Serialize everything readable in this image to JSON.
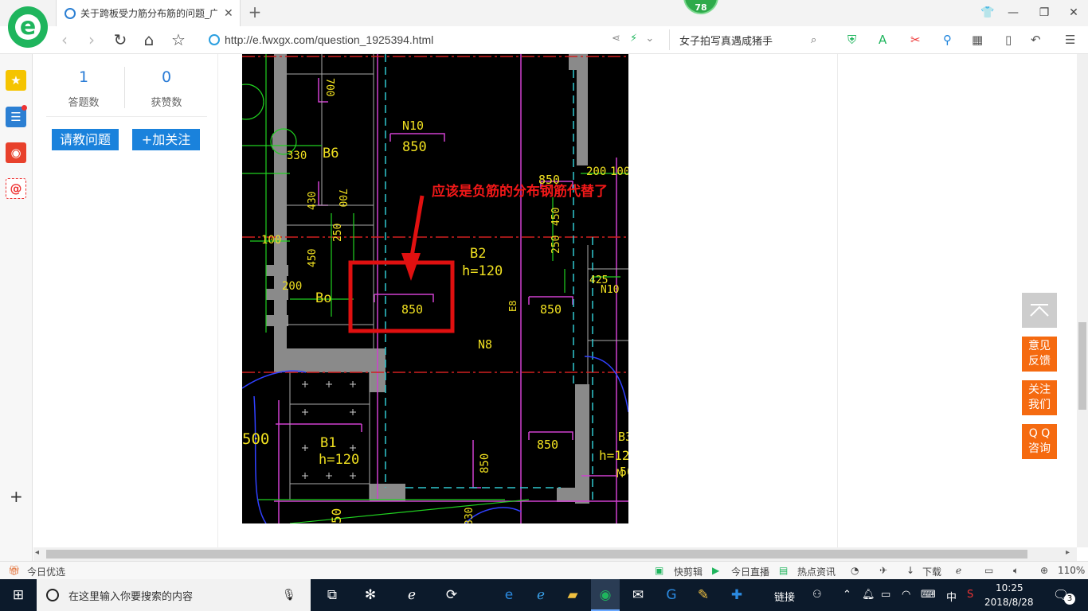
{
  "tab": {
    "title": "关于跨板受力筋分布筋的问题_广"
  },
  "badge": {
    "value": "78"
  },
  "address": {
    "url": "http://e.fwxgx.com/question_1925394.html"
  },
  "search": {
    "value": "女子拍写真遇咸猪手"
  },
  "profile": {
    "answers_count": "1",
    "answers_label": "答题数",
    "likes_count": "0",
    "likes_label": "获赞数",
    "ask_button": "请教问题",
    "follow_button": "+加关注"
  },
  "drawing": {
    "annotation": "应该是负筋的分布钢筋代替了",
    "labels": [
      "700",
      "N10",
      "850",
      "B6",
      "330",
      "700",
      "430",
      "250",
      "850",
      "200",
      "100",
      "B2",
      "h=120",
      "450",
      "250",
      "100",
      "450",
      "200",
      "Bo",
      "850",
      "E8",
      "850",
      "425",
      "N10",
      "N8",
      "500",
      "B1",
      "h=120",
      "850",
      "850",
      "850",
      "B3",
      "h=12",
      "M",
      "50",
      "50",
      "330"
    ]
  },
  "float_buttons": {
    "feedback": "意见\n反馈",
    "follow": "关注\n我们",
    "qq": "Q Q\n咨询"
  },
  "statusbar": {
    "left": "今日优选",
    "items": [
      "快剪辑",
      "今日直播",
      "热点资讯"
    ],
    "download": "下载",
    "zoom": "110%"
  },
  "taskbar": {
    "search_placeholder": "在这里输入你要搜索的内容",
    "links_label": "链接",
    "ime": "中",
    "time": "10:25",
    "date": "2018/8/28",
    "notifications": "3"
  }
}
